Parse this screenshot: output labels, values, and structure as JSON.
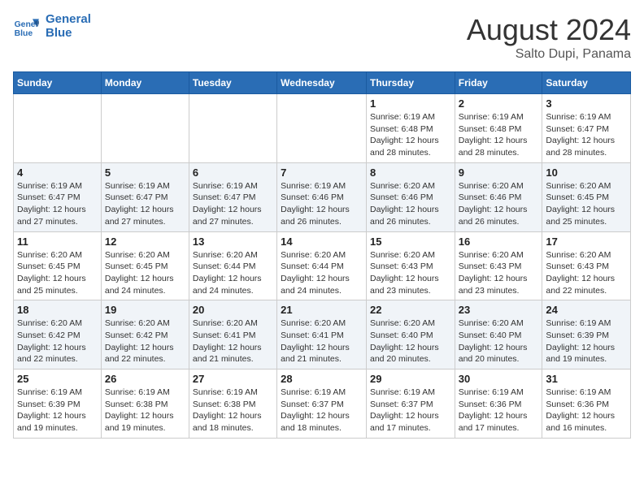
{
  "logo": {
    "line1": "General",
    "line2": "Blue"
  },
  "title": "August 2024",
  "location": "Salto Dupi, Panama",
  "days_of_week": [
    "Sunday",
    "Monday",
    "Tuesday",
    "Wednesday",
    "Thursday",
    "Friday",
    "Saturday"
  ],
  "weeks": [
    [
      {
        "day": "",
        "info": ""
      },
      {
        "day": "",
        "info": ""
      },
      {
        "day": "",
        "info": ""
      },
      {
        "day": "",
        "info": ""
      },
      {
        "day": "1",
        "info": "Sunrise: 6:19 AM\nSunset: 6:48 PM\nDaylight: 12 hours and 28 minutes."
      },
      {
        "day": "2",
        "info": "Sunrise: 6:19 AM\nSunset: 6:48 PM\nDaylight: 12 hours and 28 minutes."
      },
      {
        "day": "3",
        "info": "Sunrise: 6:19 AM\nSunset: 6:47 PM\nDaylight: 12 hours and 28 minutes."
      }
    ],
    [
      {
        "day": "4",
        "info": "Sunrise: 6:19 AM\nSunset: 6:47 PM\nDaylight: 12 hours and 27 minutes."
      },
      {
        "day": "5",
        "info": "Sunrise: 6:19 AM\nSunset: 6:47 PM\nDaylight: 12 hours and 27 minutes."
      },
      {
        "day": "6",
        "info": "Sunrise: 6:19 AM\nSunset: 6:47 PM\nDaylight: 12 hours and 27 minutes."
      },
      {
        "day": "7",
        "info": "Sunrise: 6:19 AM\nSunset: 6:46 PM\nDaylight: 12 hours and 26 minutes."
      },
      {
        "day": "8",
        "info": "Sunrise: 6:20 AM\nSunset: 6:46 PM\nDaylight: 12 hours and 26 minutes."
      },
      {
        "day": "9",
        "info": "Sunrise: 6:20 AM\nSunset: 6:46 PM\nDaylight: 12 hours and 26 minutes."
      },
      {
        "day": "10",
        "info": "Sunrise: 6:20 AM\nSunset: 6:45 PM\nDaylight: 12 hours and 25 minutes."
      }
    ],
    [
      {
        "day": "11",
        "info": "Sunrise: 6:20 AM\nSunset: 6:45 PM\nDaylight: 12 hours and 25 minutes."
      },
      {
        "day": "12",
        "info": "Sunrise: 6:20 AM\nSunset: 6:45 PM\nDaylight: 12 hours and 24 minutes."
      },
      {
        "day": "13",
        "info": "Sunrise: 6:20 AM\nSunset: 6:44 PM\nDaylight: 12 hours and 24 minutes."
      },
      {
        "day": "14",
        "info": "Sunrise: 6:20 AM\nSunset: 6:44 PM\nDaylight: 12 hours and 24 minutes."
      },
      {
        "day": "15",
        "info": "Sunrise: 6:20 AM\nSunset: 6:43 PM\nDaylight: 12 hours and 23 minutes."
      },
      {
        "day": "16",
        "info": "Sunrise: 6:20 AM\nSunset: 6:43 PM\nDaylight: 12 hours and 23 minutes."
      },
      {
        "day": "17",
        "info": "Sunrise: 6:20 AM\nSunset: 6:43 PM\nDaylight: 12 hours and 22 minutes."
      }
    ],
    [
      {
        "day": "18",
        "info": "Sunrise: 6:20 AM\nSunset: 6:42 PM\nDaylight: 12 hours and 22 minutes."
      },
      {
        "day": "19",
        "info": "Sunrise: 6:20 AM\nSunset: 6:42 PM\nDaylight: 12 hours and 22 minutes."
      },
      {
        "day": "20",
        "info": "Sunrise: 6:20 AM\nSunset: 6:41 PM\nDaylight: 12 hours and 21 minutes."
      },
      {
        "day": "21",
        "info": "Sunrise: 6:20 AM\nSunset: 6:41 PM\nDaylight: 12 hours and 21 minutes."
      },
      {
        "day": "22",
        "info": "Sunrise: 6:20 AM\nSunset: 6:40 PM\nDaylight: 12 hours and 20 minutes."
      },
      {
        "day": "23",
        "info": "Sunrise: 6:20 AM\nSunset: 6:40 PM\nDaylight: 12 hours and 20 minutes."
      },
      {
        "day": "24",
        "info": "Sunrise: 6:19 AM\nSunset: 6:39 PM\nDaylight: 12 hours and 19 minutes."
      }
    ],
    [
      {
        "day": "25",
        "info": "Sunrise: 6:19 AM\nSunset: 6:39 PM\nDaylight: 12 hours and 19 minutes."
      },
      {
        "day": "26",
        "info": "Sunrise: 6:19 AM\nSunset: 6:38 PM\nDaylight: 12 hours and 19 minutes."
      },
      {
        "day": "27",
        "info": "Sunrise: 6:19 AM\nSunset: 6:38 PM\nDaylight: 12 hours and 18 minutes."
      },
      {
        "day": "28",
        "info": "Sunrise: 6:19 AM\nSunset: 6:37 PM\nDaylight: 12 hours and 18 minutes."
      },
      {
        "day": "29",
        "info": "Sunrise: 6:19 AM\nSunset: 6:37 PM\nDaylight: 12 hours and 17 minutes."
      },
      {
        "day": "30",
        "info": "Sunrise: 6:19 AM\nSunset: 6:36 PM\nDaylight: 12 hours and 17 minutes."
      },
      {
        "day": "31",
        "info": "Sunrise: 6:19 AM\nSunset: 6:36 PM\nDaylight: 12 hours and 16 minutes."
      }
    ]
  ]
}
